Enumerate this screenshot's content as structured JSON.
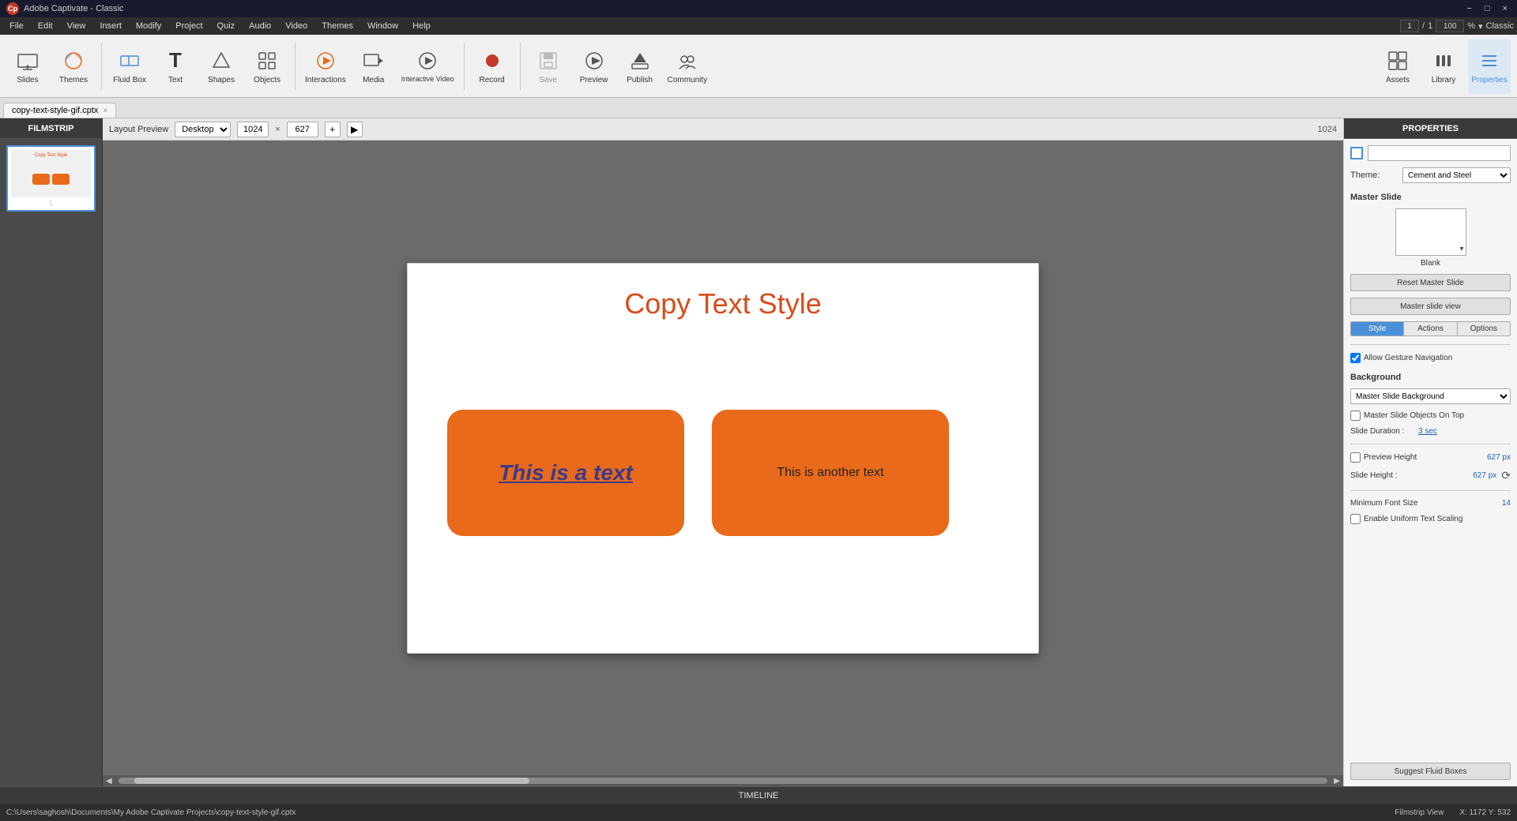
{
  "titlebar": {
    "app_name": "Adobe Captivate - Classic",
    "close_label": "×",
    "min_label": "−",
    "max_label": "□"
  },
  "menubar": {
    "items": [
      "Cp",
      "File",
      "Edit",
      "View",
      "Insert",
      "Modify",
      "Project",
      "Quiz",
      "Audio",
      "Video",
      "Themes",
      "Window",
      "Help"
    ]
  },
  "toolbar": {
    "counter_current": "1",
    "counter_sep": "/",
    "counter_total": "1",
    "zoom_value": "100",
    "items": [
      {
        "id": "slides",
        "label": "Slides",
        "icon": "⧉"
      },
      {
        "id": "themes",
        "label": "Themes",
        "icon": "🎨"
      },
      {
        "id": "fluid-box",
        "label": "Fluid Box",
        "icon": "⊞"
      },
      {
        "id": "text",
        "label": "Text",
        "icon": "T"
      },
      {
        "id": "shapes",
        "label": "Shapes",
        "icon": "△"
      },
      {
        "id": "objects",
        "label": "Objects",
        "icon": "⬚"
      },
      {
        "id": "interactions",
        "label": "Interactions",
        "icon": "⚡"
      },
      {
        "id": "media",
        "label": "Media",
        "icon": "🖼"
      },
      {
        "id": "interactive-video",
        "label": "Interactive Video",
        "icon": "▶"
      },
      {
        "id": "record",
        "label": "Record",
        "icon": "⏺"
      },
      {
        "id": "save",
        "label": "Save",
        "icon": "💾"
      },
      {
        "id": "preview",
        "label": "Preview",
        "icon": "▷"
      },
      {
        "id": "publish",
        "label": "Publish",
        "icon": "⬆"
      },
      {
        "id": "community",
        "label": "Community",
        "icon": "👥"
      }
    ],
    "right_items": [
      {
        "id": "assets",
        "label": "Assets",
        "icon": "🗂"
      },
      {
        "id": "library",
        "label": "Library",
        "icon": "📚"
      },
      {
        "id": "properties",
        "label": "Properties",
        "icon": "≡"
      }
    ]
  },
  "tabbar": {
    "tabs": [
      {
        "id": "main-tab",
        "label": "copy-text-style-gif.cptx",
        "closable": true
      }
    ]
  },
  "filmstrip": {
    "header": "FILMSTRIP",
    "slides": [
      {
        "number": "1",
        "title": "Copy Text Style",
        "boxes": [
          "orange-box-1",
          "orange-box-2"
        ]
      }
    ]
  },
  "canvas": {
    "toolbar": {
      "layout_preview_label": "Layout Preview",
      "desktop_option": "Desktop",
      "width_value": "1024",
      "height_value": "627",
      "current_size": "1024"
    },
    "slide": {
      "title": "Copy Text Style",
      "box1_text": "This is a text",
      "box2_text": "This is another text"
    }
  },
  "properties": {
    "header": "PROPERTIES",
    "color_swatch": "#fff",
    "theme_label": "Theme:",
    "theme_value": "Cement and Steel",
    "master_slide_header": "Master Slide",
    "master_slide_name": "Blank",
    "reset_master_slide_btn": "Reset Master Slide",
    "master_slide_view_btn": "Master slide view",
    "tabs": [
      "Style",
      "Actions",
      "Options"
    ],
    "active_tab": "Style",
    "allow_gesture_label": "Allow Gesture Navigation",
    "background_label": "Background",
    "background_value": "Master Slide Background",
    "master_objects_label": "Master Slide Objects On Top",
    "slide_duration_label": "Slide Duration :",
    "slide_duration_value": "3 sec",
    "preview_height_label": "Preview Height",
    "preview_height_value": "627 px",
    "slide_height_label": "Slide Height :",
    "slide_height_value": "627 px",
    "min_font_label": "Minimum Font Size",
    "min_font_value": "14",
    "uniform_text_label": "Enable Uniform Text Scaling",
    "suggest_btn": "Suggest Fluid Boxes"
  },
  "timeline": {
    "label": "TIMELINE"
  },
  "statusbar": {
    "filepath": "C:\\Users\\saghosh\\Documents\\My Adobe Captivate Projects\\copy-text-style-gif.cptx",
    "view_label": "Filmstrip View",
    "coords": "X: 1172 Y: 532"
  },
  "colors": {
    "orange": "#e86a1a",
    "title_red": "#d84c1a",
    "text_blue": "#3a3a8c",
    "brand_red": "#c0392b",
    "active_blue": "#4a90d9"
  }
}
